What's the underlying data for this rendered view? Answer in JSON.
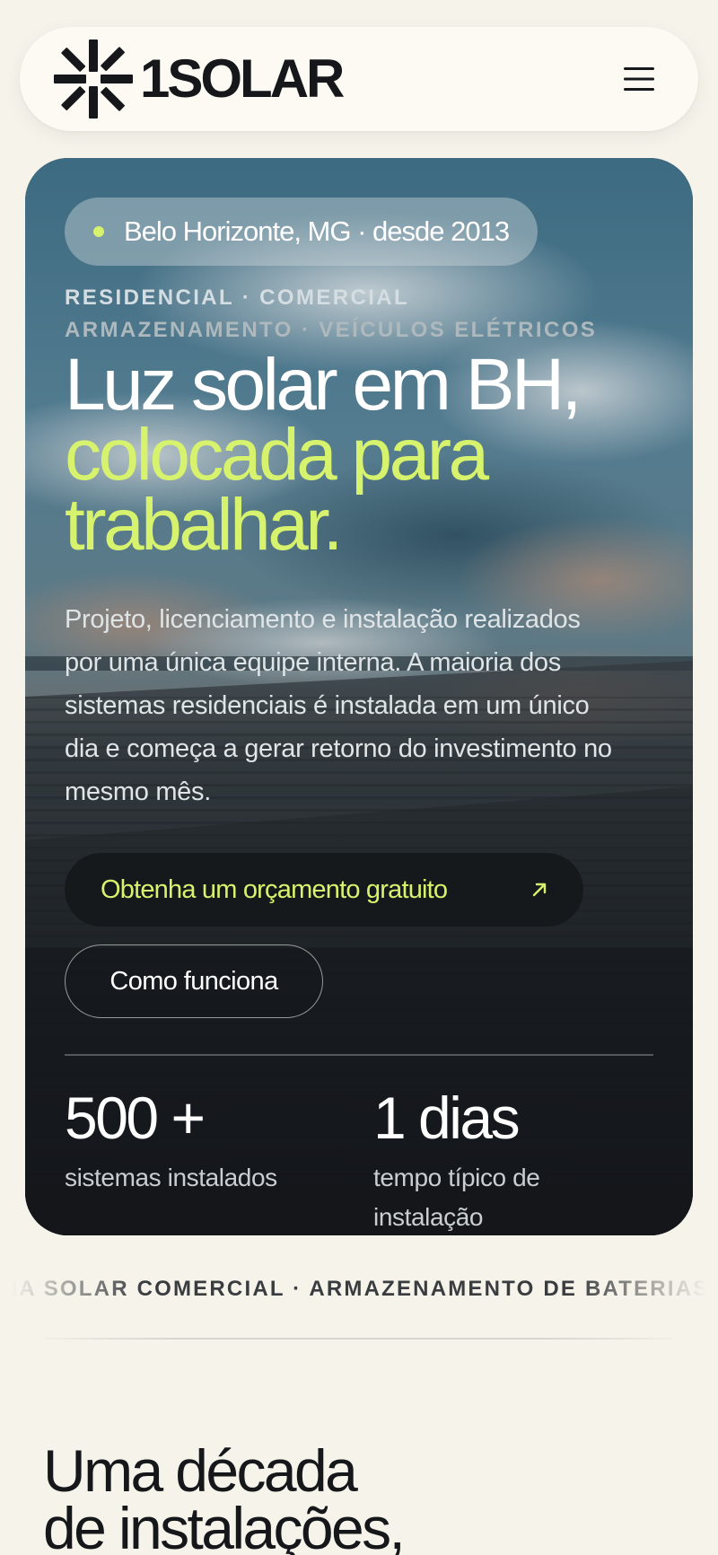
{
  "header": {
    "logo_text": "1SOLAR",
    "logo_icon": "starburst-logo-icon",
    "menu_icon": "hamburger-menu-icon"
  },
  "hero": {
    "location": "Belo Horizonte, MG · desde 2013",
    "eyebrow_line1": "RESIDENCIAL · COMERCIAL",
    "eyebrow_line2": "ARMAZENAMENTO · VEÍCULOS ELÉTRICOS",
    "headline_line1": "Luz solar em BH,",
    "headline_line2": "colocada para",
    "headline_line3": "trabalhar.",
    "description": "Projeto, licenciamento e instalação realizados por uma única equipe interna. A maioria dos sistemas residenciais é instalada em um único dia e começa a gerar retorno do investimento no mesmo mês.",
    "cta_primary": "Obtenha um orçamento gratuito",
    "cta_primary_icon": "arrow-up-right-icon",
    "cta_secondary": "Como funciona",
    "stats": [
      {
        "value": "500 +",
        "label": "sistemas instalados"
      },
      {
        "value": "1 dias",
        "label": "tempo típico de instalação"
      }
    ]
  },
  "marquee": {
    "text": "ENERGIA SOLAR COMERCIAL · ARMAZENAMENTO DE BATERIAS"
  },
  "section": {
    "title_line1": "Uma década",
    "title_line2": "de instalações,"
  },
  "colors": {
    "accent_lime": "#d7f36d",
    "page_bg": "#f5f3ea",
    "dark": "#16191c"
  }
}
